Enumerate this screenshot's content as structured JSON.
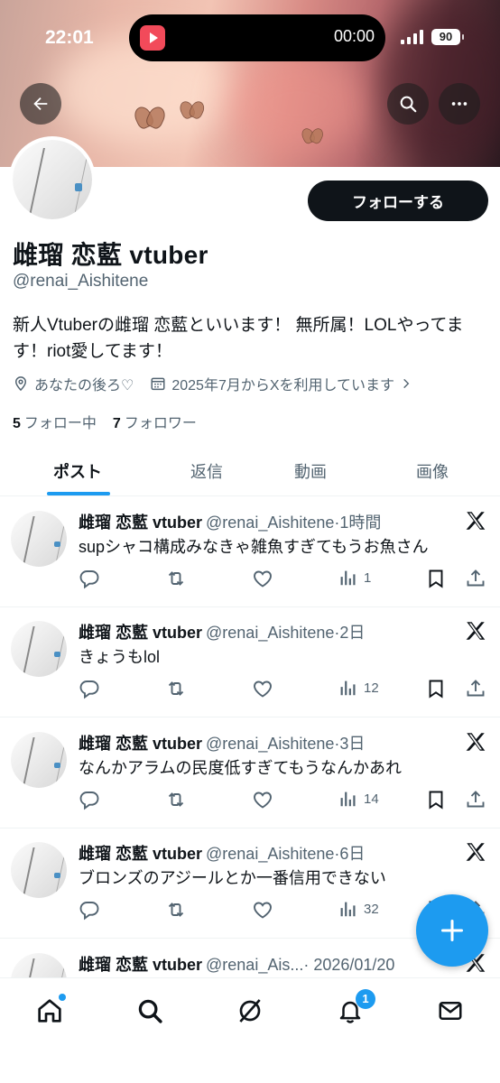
{
  "status_bar": {
    "time": "22:01",
    "timer": "00:00",
    "battery": "90"
  },
  "profile": {
    "follow_label": "フォローする",
    "name": "雌瑠 恋藍 vtuber",
    "handle": "@renai_Aishitene",
    "bio": "新人Vtuberの雌瑠 恋藍といいます！ 無所属！LOLやってます！riot愛してます！",
    "location": "あなたの後ろ♡",
    "joined": "2025年7月からXを利用しています",
    "following_count": "5",
    "following_label": "フォロー中",
    "followers_count": "7",
    "followers_label": "フォロワー"
  },
  "tabs": [
    {
      "label": "ポスト",
      "active": true
    },
    {
      "label": "返信",
      "active": false
    },
    {
      "label": "動画",
      "active": false
    },
    {
      "label": "画像",
      "active": false
    }
  ],
  "posts": [
    {
      "name": "雌瑠 恋藍 vtuber",
      "handle": "@renai_Aishitene",
      "time": "·1時間",
      "text": "supシャコ構成みなきゃ雑魚すぎてもうお魚さん",
      "views": "1"
    },
    {
      "name": "雌瑠 恋藍 vtuber",
      "handle": "@renai_Aishitene",
      "time": "·2日",
      "text": "きょうもlol",
      "views": "12"
    },
    {
      "name": "雌瑠 恋藍 vtuber",
      "handle": "@renai_Aishitene",
      "time": "·3日",
      "text": "なんかアラムの民度低すぎてもうなんかあれ",
      "views": "14"
    },
    {
      "name": "雌瑠 恋藍 vtuber",
      "handle": "@renai_Aishitene",
      "time": "·6日",
      "text": "ブロンズのアジールとか一番信用できない",
      "views": "32"
    },
    {
      "name": "雌瑠 恋藍 vtuber",
      "handle": "@renai_Ais...",
      "time": "· 2026/01/20",
      "text": "",
      "views": ""
    }
  ],
  "bottom_nav": {
    "notifications_badge": "1"
  },
  "colors": {
    "accent": "#1d9bf0",
    "text": "#0f1419",
    "muted": "#536471"
  },
  "icons": [
    "back-arrow-icon",
    "search-icon",
    "more-icon",
    "location-pin-icon",
    "calendar-icon",
    "chevron-right-icon",
    "reply-icon",
    "repost-icon",
    "like-icon",
    "views-icon",
    "bookmark-icon",
    "share-icon",
    "x-logo-icon",
    "plus-icon",
    "home-icon",
    "grok-icon",
    "bell-icon",
    "mail-icon"
  ]
}
